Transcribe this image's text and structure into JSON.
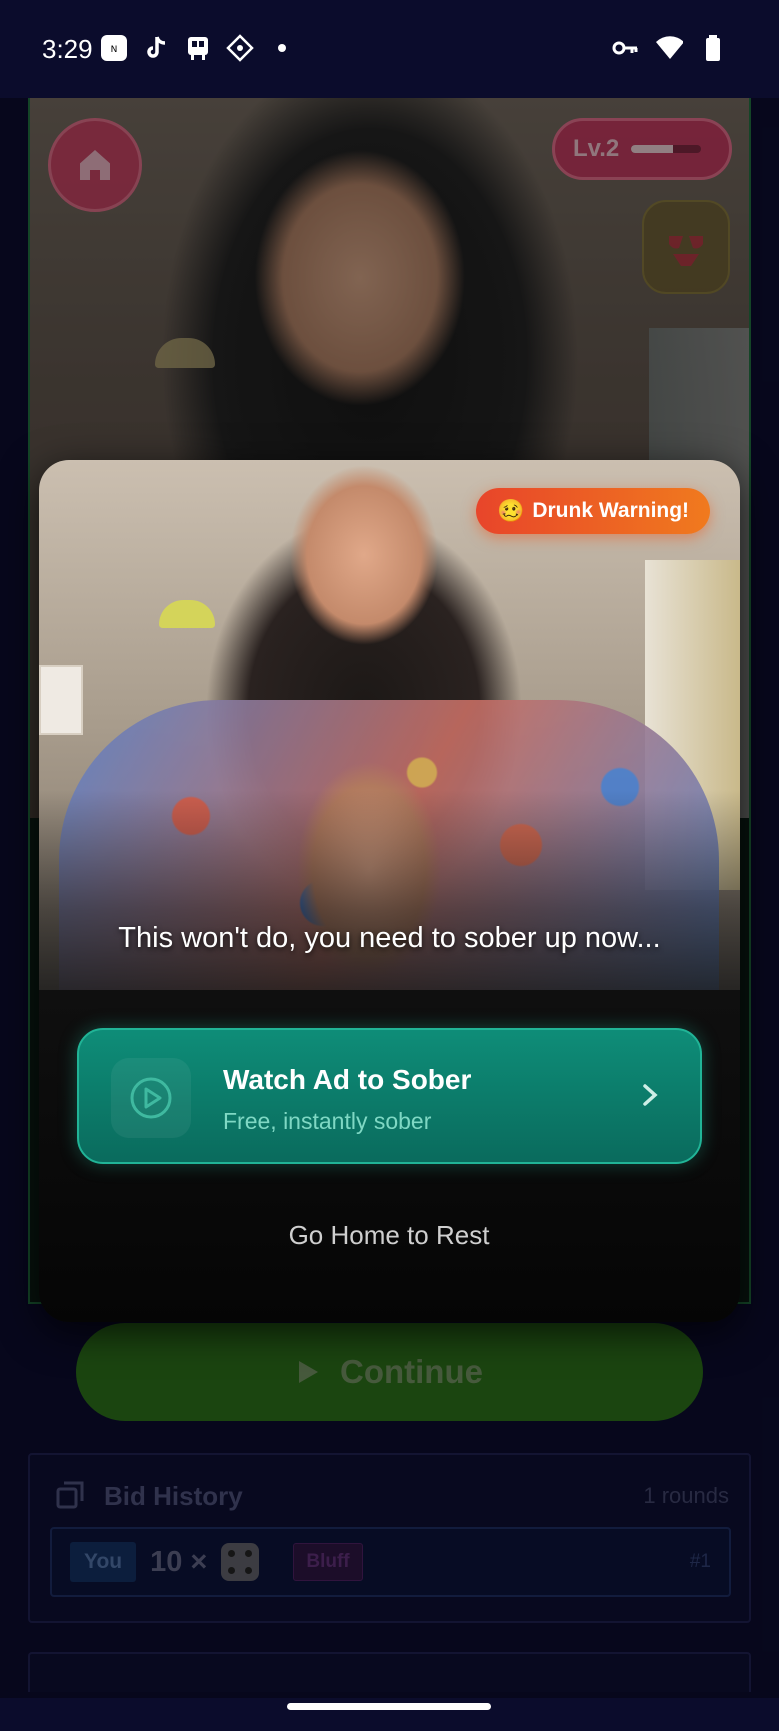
{
  "status_bar": {
    "time": "3:29",
    "left_icons": [
      "news-app-icon",
      "tiktok-icon",
      "transit-icon",
      "game-icon",
      "dot-icon"
    ],
    "right_icons": [
      "vpn-key-icon",
      "wifi-icon",
      "battery-icon"
    ]
  },
  "game": {
    "level_label": "Lv.2",
    "level_progress": 0.6,
    "continue_label": "Continue",
    "bid_history": {
      "title": "Bid History",
      "rounds": "1 rounds",
      "rows": [
        {
          "player": "You",
          "quantity": "10 ×",
          "die_face": 4,
          "tag": "Bluff",
          "index": "#1"
        }
      ]
    }
  },
  "modal": {
    "badge_emoji": "🥴",
    "badge_text": "Drunk Warning!",
    "message": "This won't do, you need to sober up now...",
    "watch_ad": {
      "title": "Watch Ad to Sober",
      "subtitle": "Free, instantly sober"
    },
    "go_home_label": "Go Home to Rest"
  },
  "colors": {
    "background": "#0b0c2c",
    "accent_teal": "#0e8d78",
    "warning_orange": "#f07a1e",
    "level_pink": "#c2325a",
    "continue_green": "#2a6b1a"
  }
}
